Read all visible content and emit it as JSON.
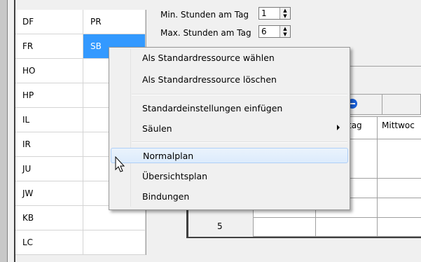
{
  "grid_rows": [
    {
      "code": "DF",
      "value": "PR"
    },
    {
      "code": "FR",
      "value": "SB"
    },
    {
      "code": "HO",
      "value": ""
    },
    {
      "code": "HP",
      "value": ""
    },
    {
      "code": "IL",
      "value": ""
    },
    {
      "code": "IR",
      "value": ""
    },
    {
      "code": "JU",
      "value": ""
    },
    {
      "code": "JW",
      "value": ""
    },
    {
      "code": "KB",
      "value": ""
    },
    {
      "code": "LC",
      "value": ""
    }
  ],
  "settings": {
    "min_label": "Min. Stunden am Tag",
    "min_value": "1",
    "max_label": "Max. Stunden am Tag",
    "max_value": "6"
  },
  "table": {
    "col_partial_1": "tag",
    "col_partial_2": "Mittwoc",
    "row_number": "5"
  },
  "context_menu": {
    "items": [
      "Als Standardressource wählen",
      "Als Standardressource löschen",
      "Standardeinstellungen einfügen",
      "Säulen",
      "Normalplan",
      "Übersichtsplan",
      "Bindungen"
    ],
    "highlighted": "Normalplan"
  },
  "colors": {
    "selection": "#3399ff",
    "menu_bg": "#f0f0f0",
    "highlight": "#dcebfc"
  }
}
